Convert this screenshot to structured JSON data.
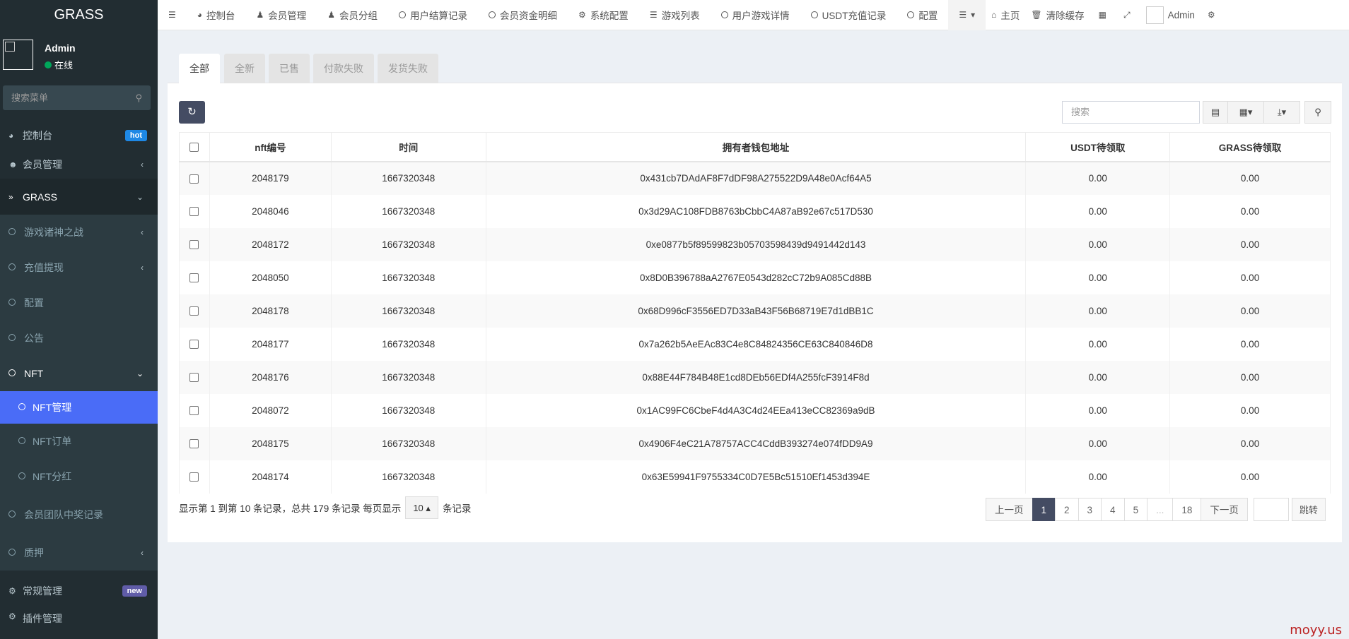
{
  "sidebar": {
    "logo": "GRASS",
    "user": {
      "name": "Admin",
      "status": "在线"
    },
    "search_placeholder": "搜索菜单",
    "items": [
      {
        "label": "控制台",
        "badge": "hot"
      },
      {
        "label": "会员管理"
      },
      {
        "label": "GRASS"
      },
      {
        "label": "游戏诸神之战"
      },
      {
        "label": "充值提现"
      },
      {
        "label": "配置"
      },
      {
        "label": "公告"
      },
      {
        "label": "NFT"
      },
      {
        "label": "NFT管理"
      },
      {
        "label": "NFT订单"
      },
      {
        "label": "NFT分红"
      },
      {
        "label": "会员团队中奖记录"
      },
      {
        "label": "质押"
      },
      {
        "label": "常规管理",
        "badge": "new"
      },
      {
        "label": "插件管理"
      }
    ]
  },
  "topnav": {
    "items": [
      "控制台",
      "会员管理",
      "会员分组",
      "用户结算记录",
      "会员资金明细",
      "系统配置",
      "游戏列表",
      "用户游戏详情",
      "USDT充值记录",
      "配置"
    ],
    "home": "主页",
    "clear_cache": "清除缓存",
    "admin": "Admin"
  },
  "tabs": [
    "全部",
    "全新",
    "已售",
    "付款失败",
    "发货失败"
  ],
  "toolbar": {
    "search_placeholder": "搜索"
  },
  "table": {
    "columns": [
      "nft编号",
      "时间",
      "拥有者钱包地址",
      "USDT待领取",
      "GRASS待领取"
    ],
    "rows": [
      [
        "2048179",
        "1667320348",
        "0x431cb7DAdAF8F7dDF98A275522D9A48e0Acf64A5",
        "0.00",
        "0.00"
      ],
      [
        "2048046",
        "1667320348",
        "0x3d29AC108FDB8763bCbbC4A87aB92e67c517D530",
        "0.00",
        "0.00"
      ],
      [
        "2048172",
        "1667320348",
        "0xe0877b5f89599823b05703598439d9491442d143",
        "0.00",
        "0.00"
      ],
      [
        "2048050",
        "1667320348",
        "0x8D0B396788aA2767E0543d282cC72b9A085Cd88B",
        "0.00",
        "0.00"
      ],
      [
        "2048178",
        "1667320348",
        "0x68D996cF3556ED7D33aB43F56B68719E7d1dBB1C",
        "0.00",
        "0.00"
      ],
      [
        "2048177",
        "1667320348",
        "0x7a262b5AeEAc83C4e8C84824356CE63C840846D8",
        "0.00",
        "0.00"
      ],
      [
        "2048176",
        "1667320348",
        "0x88E44F784B48E1cd8DEb56EDf4A255fcF3914F8d",
        "0.00",
        "0.00"
      ],
      [
        "2048072",
        "1667320348",
        "0x1AC99FC6CbeF4d4A3C4d24EEa413eCC82369a9dB",
        "0.00",
        "0.00"
      ],
      [
        "2048175",
        "1667320348",
        "0x4906F4eC21A78757ACC4CddB393274e074fDD9A9",
        "0.00",
        "0.00"
      ],
      [
        "2048174",
        "1667320348",
        "0x63E59941F9755334C0D7E5Bc51510Ef1453d394E",
        "0.00",
        "0.00"
      ]
    ]
  },
  "pager": {
    "info": "显示第 1 到第 10 条记录，总共 179 条记录 每页显示",
    "page_size": "10",
    "suffix": "条记录",
    "prev": "上一页",
    "pages": [
      "1",
      "2",
      "3",
      "4",
      "5",
      "...",
      "18"
    ],
    "next": "下一页",
    "goto": "跳转"
  },
  "watermark": "moyy.us",
  "colors": {
    "sidebar_bg": "#222d32",
    "active_menu": "#4a6cf7",
    "primary_btn": "#444c63"
  }
}
